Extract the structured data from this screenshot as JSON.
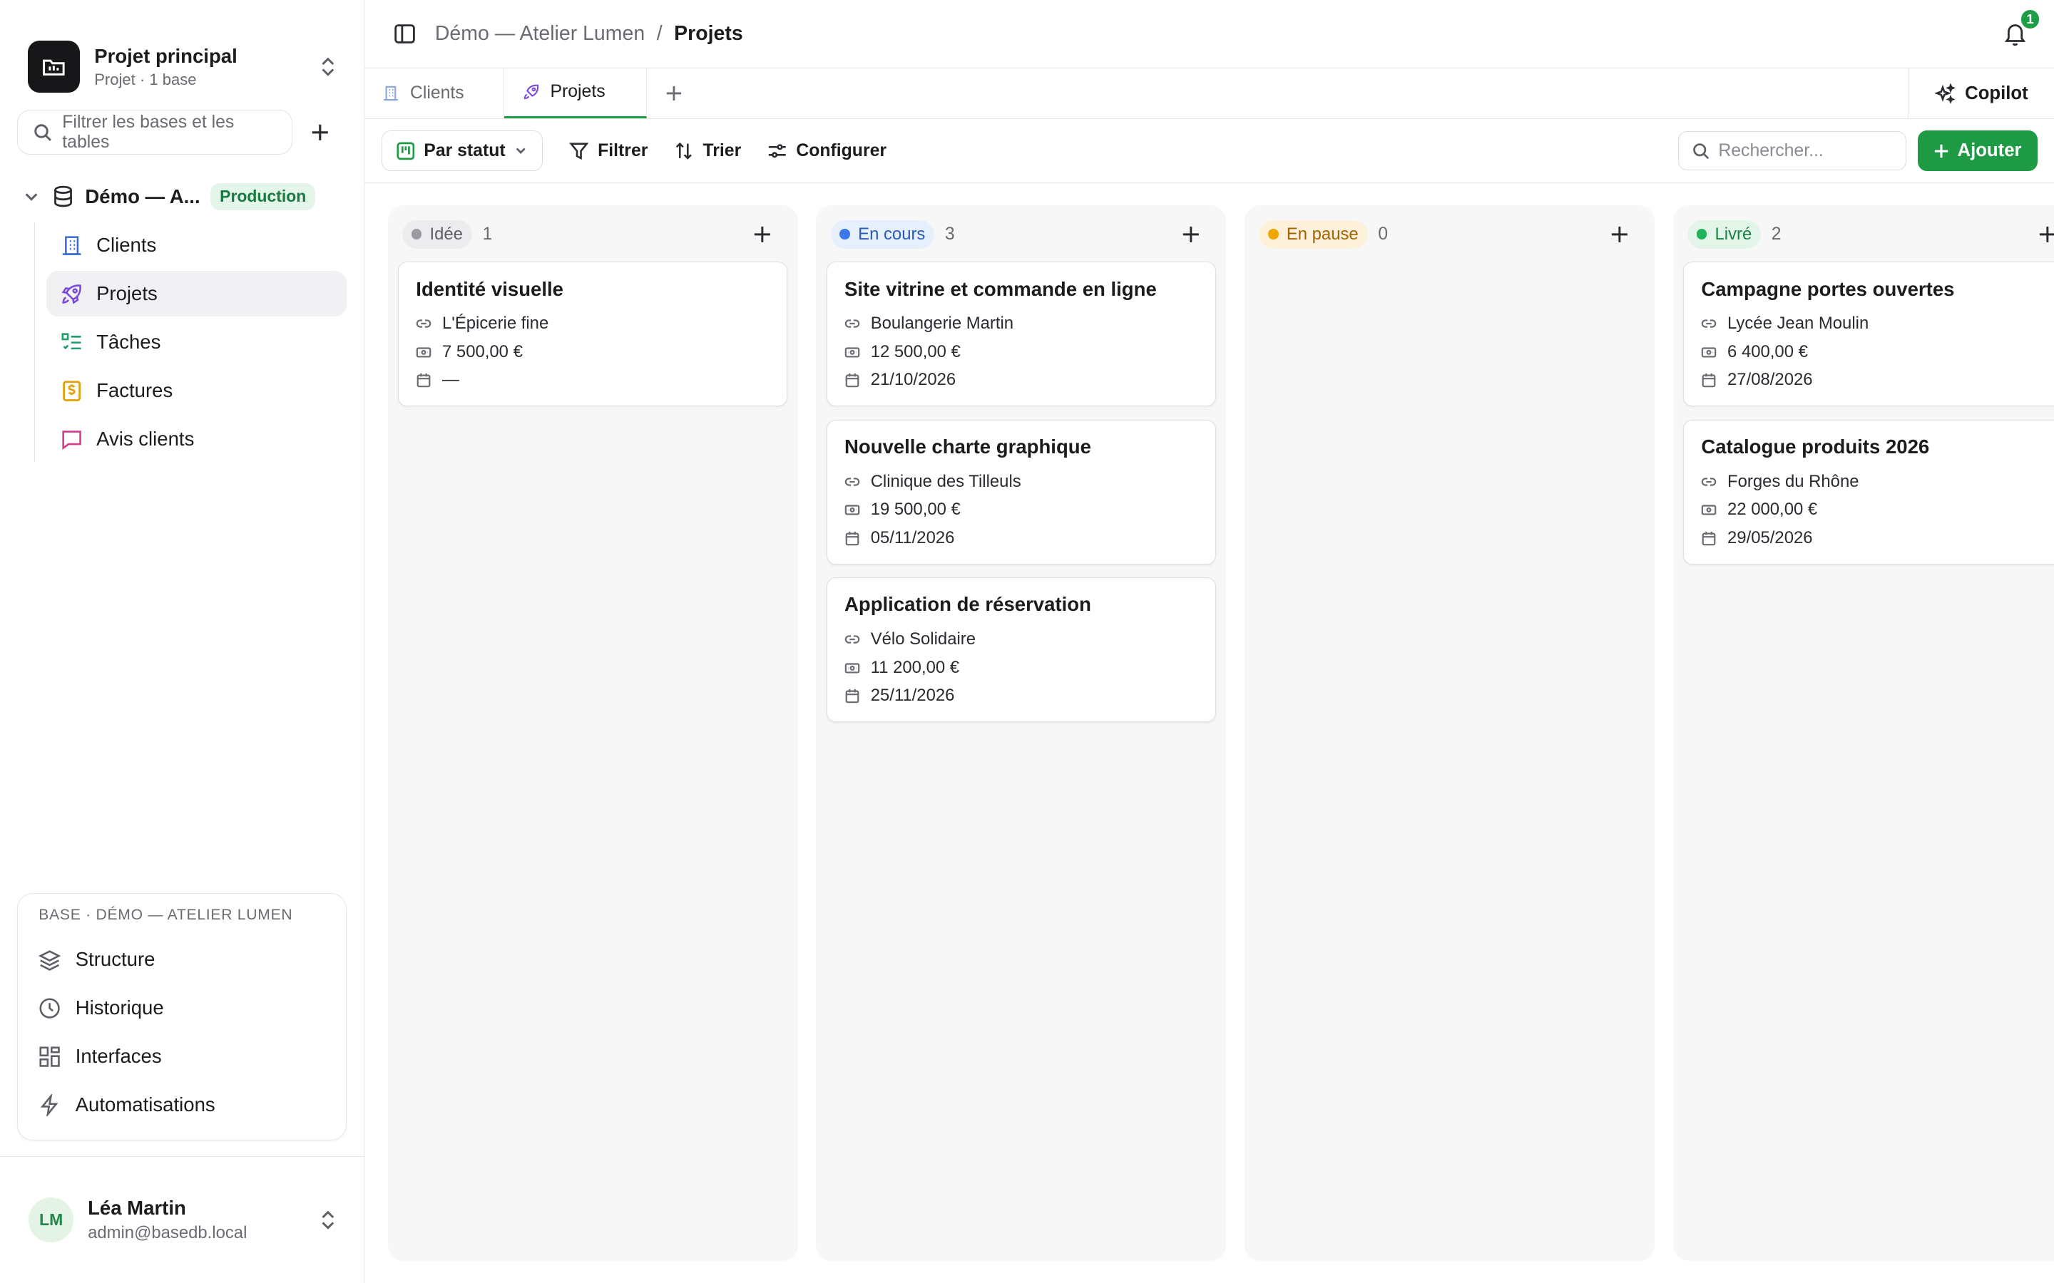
{
  "project": {
    "name": "Projet principal",
    "subtitle": "Projet · 1 base"
  },
  "sidebar": {
    "filter_placeholder": "Filtrer les bases et les tables",
    "base": {
      "name": "Démo — A...",
      "badge": "Production"
    },
    "tables": [
      {
        "label": "Clients",
        "icon": "building-icon",
        "color": "#3b6fd8"
      },
      {
        "label": "Projets",
        "icon": "rocket-icon",
        "color": "#7b4ad8",
        "active": true
      },
      {
        "label": "Tâches",
        "icon": "checklist-icon",
        "color": "#1f9d6b"
      },
      {
        "label": "Factures",
        "icon": "invoice-icon",
        "color": "#e3a008"
      },
      {
        "label": "Avis clients",
        "icon": "chat-icon",
        "color": "#d63b8a"
      }
    ],
    "base_panel": {
      "title": "BASE · DÉMO — ATELIER LUMEN",
      "items": [
        {
          "label": "Structure",
          "icon": "layers-icon"
        },
        {
          "label": "Historique",
          "icon": "clock-icon"
        },
        {
          "label": "Interfaces",
          "icon": "grid-icon"
        },
        {
          "label": "Automatisations",
          "icon": "bolt-icon"
        }
      ]
    },
    "user": {
      "initials": "LM",
      "name": "Léa Martin",
      "email": "admin@basedb.local"
    }
  },
  "topbar": {
    "breadcrumb_parent": "Démo — Atelier Lumen",
    "separator": "/",
    "breadcrumb_current": "Projets",
    "notifications": "1"
  },
  "tabs": [
    {
      "label": "Clients"
    },
    {
      "label": "Projets",
      "active": true
    }
  ],
  "copilot": "Copilot",
  "toolbar": {
    "view": "Par statut",
    "filter": "Filtrer",
    "sort": "Trier",
    "configure": "Configurer",
    "search_placeholder": "Rechercher...",
    "add": "Ajouter"
  },
  "accent": "#1e9a45",
  "columns": [
    {
      "label": "Idée",
      "count": "1",
      "dot": "#9a9aa2",
      "bg": "#ececef",
      "fg": "#5e5e66",
      "cards": [
        {
          "title": "Identité visuelle",
          "client": "L'Épicerie fine",
          "amount": "7 500,00 €",
          "date": "—"
        }
      ]
    },
    {
      "label": "En cours",
      "count": "3",
      "dot": "#3b7ae8",
      "bg": "#e6effc",
      "fg": "#2a5bb8",
      "cards": [
        {
          "title": "Site vitrine et commande en ligne",
          "client": "Boulangerie Martin",
          "amount": "12 500,00 €",
          "date": "21/10/2026"
        },
        {
          "title": "Nouvelle charte graphique",
          "client": "Clinique des Tilleuls",
          "amount": "19 500,00 €",
          "date": "05/11/2026"
        },
        {
          "title": "Application de réservation",
          "client": "Vélo Solidaire",
          "amount": "11 200,00 €",
          "date": "25/11/2026"
        }
      ]
    },
    {
      "label": "En pause",
      "count": "0",
      "dot": "#f0a500",
      "bg": "#fdf1dc",
      "fg": "#a16400",
      "cards": []
    },
    {
      "label": "Livré",
      "count": "2",
      "dot": "#22b35a",
      "bg": "#e3f5e9",
      "fg": "#1b8045",
      "cards": [
        {
          "title": "Campagne portes ouvertes",
          "client": "Lycée Jean Moulin",
          "amount": "6 400,00 €",
          "date": "27/08/2026"
        },
        {
          "title": "Catalogue produits 2026",
          "client": "Forges du Rhône",
          "amount": "22 000,00 €",
          "date": "29/05/2026"
        }
      ]
    }
  ]
}
